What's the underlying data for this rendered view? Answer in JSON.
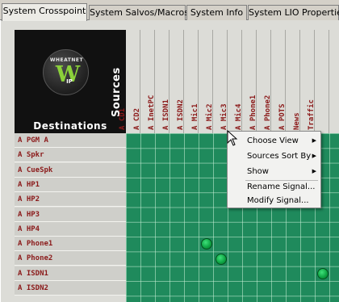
{
  "tabs": [
    {
      "label": "System Crosspoint",
      "active": true
    },
    {
      "label": "System Salvos/Macros",
      "active": false
    },
    {
      "label": "System Info",
      "active": false
    },
    {
      "label": "System LIO Properties",
      "active": false
    }
  ],
  "logo": {
    "ring_text": "WHEATNET",
    "subtext": "IP",
    "letter": "W"
  },
  "corner": {
    "sources_label": "Sources",
    "destinations_label": "Destinations"
  },
  "sources": [
    "A CD1",
    "A CD2",
    "A InetPC",
    "A ISDN1",
    "A ISDN2",
    "A Mic1",
    "A Mic2",
    "A Mic3",
    "A Mic4",
    "A Phone1",
    "A Phone2",
    "A POTS",
    "News",
    "Traffic"
  ],
  "destinations": [
    "A PGM A",
    "A Spkr",
    "A CueSpk",
    "A HP1",
    "A HP2",
    "A HP3",
    "A HP4",
    "A Phone1",
    "A Phone2",
    "A ISDN1",
    "A ISDN2"
  ],
  "crosspoints": [
    {
      "destination": "A Phone1",
      "source": "A Mic1"
    },
    {
      "destination": "A Phone2",
      "source": "A Mic2"
    },
    {
      "destination": "A ISDN1",
      "source": "Traffic"
    }
  ],
  "context_menu": {
    "items": [
      {
        "label": "Choose View",
        "submenu": true
      },
      {
        "label": "Sources Sort By",
        "submenu": true
      },
      {
        "label": "Show",
        "submenu": true
      },
      {
        "label": "Rename Signal...",
        "submenu": false
      },
      {
        "label": "Modify Signal...",
        "submenu": false
      }
    ]
  },
  "colors": {
    "grid": "#1f8a5c",
    "connection": "#0fa645",
    "label_text": "#8b1a1a",
    "logo_green": "#8bd13a"
  }
}
